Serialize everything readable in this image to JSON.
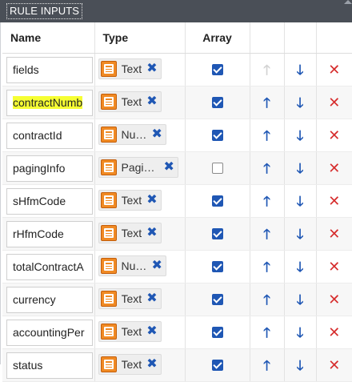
{
  "panel": {
    "title": "RULE INPUTS"
  },
  "columns": {
    "name": "Name",
    "type": "Type",
    "array": "Array"
  },
  "icons": {
    "up": "arrow-up-icon",
    "down": "arrow-down-icon",
    "delete": "delete-icon",
    "remove_type": "remove-type-icon",
    "data_type": "data-type-icon"
  },
  "colors": {
    "accent_blue": "#1f57b4",
    "delete_red": "#d62d2d",
    "type_orange": "#f08a24",
    "highlight": "#f6ff33"
  },
  "rows": [
    {
      "name": "fields",
      "type": "Text",
      "array": true,
      "up_enabled": false
    },
    {
      "name": "contractNumb",
      "type": "Text",
      "array": true,
      "up_enabled": true,
      "highlighted": true
    },
    {
      "name": "contractId",
      "type": "Num…",
      "array": true,
      "up_enabled": true
    },
    {
      "name": "pagingInfo",
      "type": "Pagin…",
      "array": false,
      "up_enabled": true
    },
    {
      "name": "sHfmCode",
      "type": "Text",
      "array": true,
      "up_enabled": true
    },
    {
      "name": "rHfmCode",
      "type": "Text",
      "array": true,
      "up_enabled": true
    },
    {
      "name": "totalContractA",
      "type": "Num…",
      "array": true,
      "up_enabled": true
    },
    {
      "name": "currency",
      "type": "Text",
      "array": true,
      "up_enabled": true
    },
    {
      "name": "accountingPer",
      "type": "Text",
      "array": true,
      "up_enabled": true
    },
    {
      "name": "status",
      "type": "Text",
      "array": true,
      "up_enabled": true
    }
  ],
  "symbols": {
    "remove": "✖",
    "up": "🡑",
    "down": "🡓",
    "delete": "✕"
  }
}
